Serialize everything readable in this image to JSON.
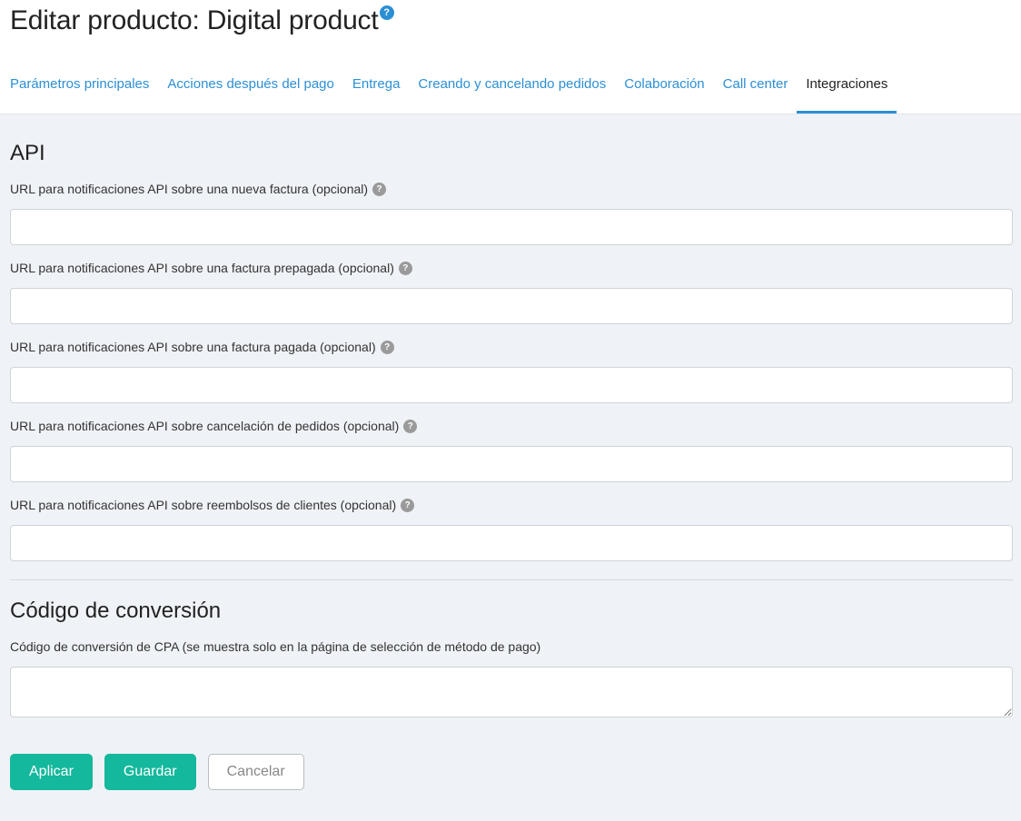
{
  "header": {
    "title": "Editar producto: Digital product",
    "help_symbol": "?"
  },
  "tabs": [
    {
      "label": "Parámetros principales",
      "active": false
    },
    {
      "label": "Acciones después del pago",
      "active": false
    },
    {
      "label": "Entrega",
      "active": false
    },
    {
      "label": "Creando y cancelando pedidos",
      "active": false
    },
    {
      "label": "Colaboración",
      "active": false
    },
    {
      "label": "Call center",
      "active": false
    },
    {
      "label": "Integraciones",
      "active": true
    }
  ],
  "api": {
    "title": "API",
    "fields": [
      {
        "label": "URL para notificaciones API sobre una nueva factura (opcional)",
        "value": ""
      },
      {
        "label": "URL para notificaciones API sobre una factura prepagada (opcional)",
        "value": ""
      },
      {
        "label": "URL para notificaciones API sobre una factura pagada (opcional)",
        "value": ""
      },
      {
        "label": "URL para notificaciones API sobre cancelación de pedidos (opcional)",
        "value": ""
      },
      {
        "label": "URL para notificaciones API sobre reembolsos de clientes (opcional)",
        "value": ""
      }
    ],
    "help_symbol": "?"
  },
  "conversion": {
    "title": "Código de conversión",
    "label": "Código de conversión de CPA (se muestra solo en la página de selección de método de pago)",
    "value": ""
  },
  "actions": {
    "apply_label": "Aplicar",
    "save_label": "Guardar",
    "cancel_label": "Cancelar"
  },
  "colors": {
    "accent": "#2b8fd6",
    "primary_button": "#14b89c",
    "background": "#eff2f6"
  }
}
